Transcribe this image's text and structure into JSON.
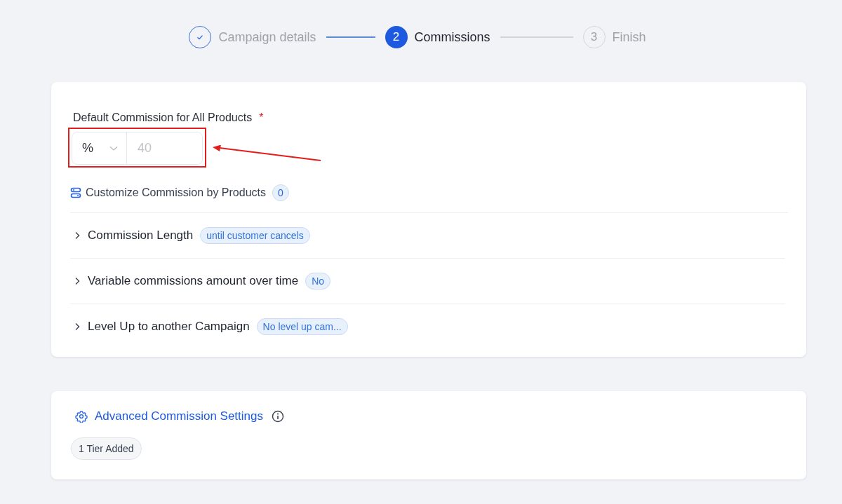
{
  "steps": [
    {
      "label": "Campaign details",
      "completed": true,
      "selected": false
    },
    {
      "number": "2",
      "label": "Commissions",
      "completed": false,
      "selected": true
    },
    {
      "number": "3",
      "label": "Finish",
      "completed": false,
      "selected": false
    }
  ],
  "default_commission": {
    "label": "Default Commission for All Products",
    "required_mark": "*",
    "unit": "%",
    "placeholder": "40",
    "highlighted": true
  },
  "customize": {
    "label": "Customize Commission by Products",
    "count": "0"
  },
  "sections": [
    {
      "label": "Commission Length",
      "badge": "until customer cancels",
      "expanded": false
    },
    {
      "label": "Variable commissions amount over time",
      "badge": "No",
      "expanded": false
    },
    {
      "label": "Level Up to another Campaign",
      "badge": "No level up cam...",
      "expanded": false
    }
  ],
  "advanced": {
    "title": "Advanced Commission Settings",
    "tier_badge": "1 Tier Added"
  }
}
